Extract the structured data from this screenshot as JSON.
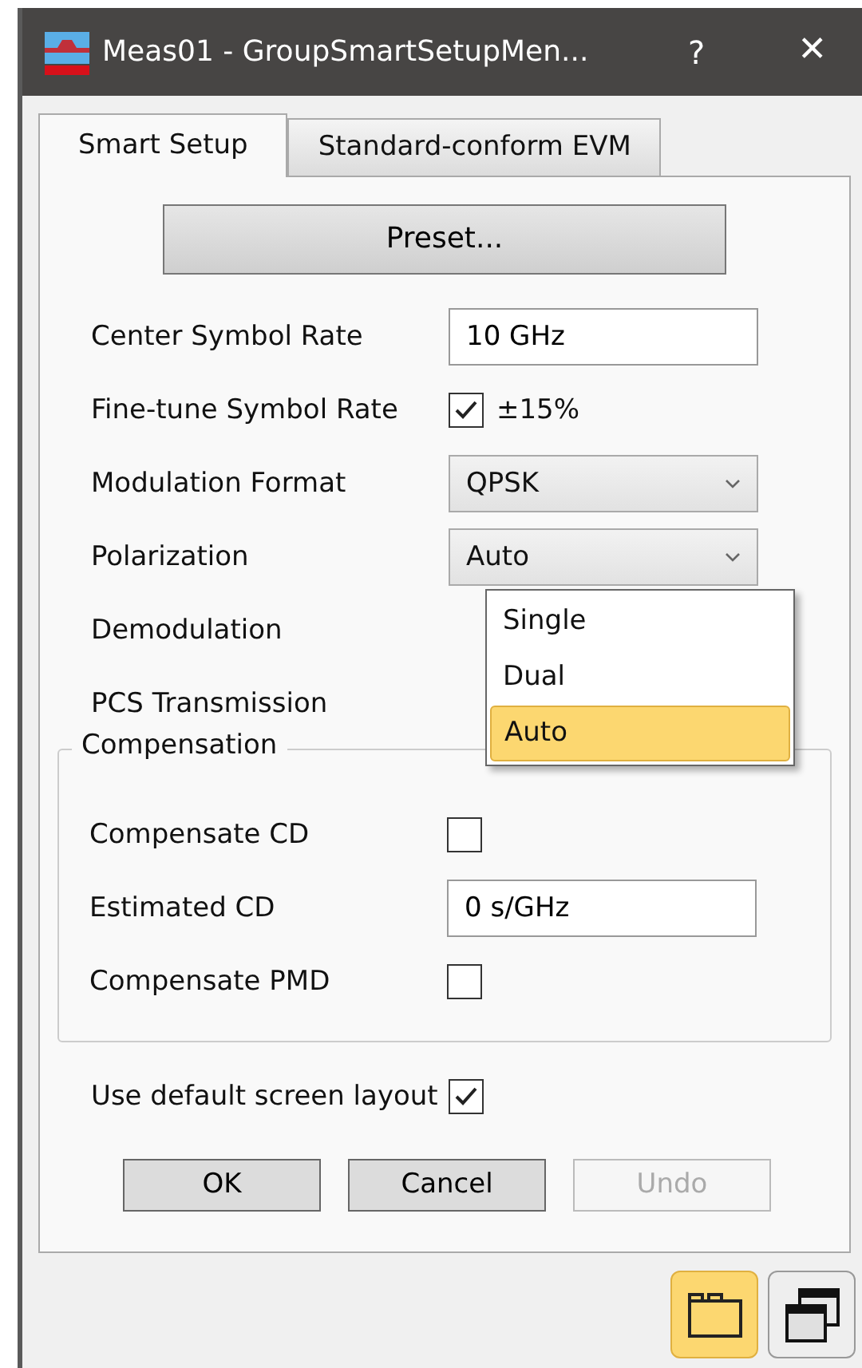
{
  "window": {
    "title": "Meas01 - GroupSmartSetupMen...",
    "help": "?",
    "close": "✕"
  },
  "tabs": [
    {
      "label": "Smart Setup",
      "selected": true
    },
    {
      "label": "Standard-conform EVM",
      "selected": false
    }
  ],
  "preset_button": "Preset...",
  "settings": [
    {
      "kind": "text",
      "label": "Center Symbol Rate",
      "value": "10 GHz"
    },
    {
      "kind": "checkbox",
      "label": "Fine-tune Symbol Rate",
      "checked": true,
      "text": "±15%"
    },
    {
      "kind": "dropdown",
      "label": "Modulation Format",
      "value": "QPSK"
    },
    {
      "kind": "dropdown",
      "label": "Polarization",
      "value": "Auto",
      "expanded": true,
      "options": [
        {
          "label": "Single",
          "selected": false
        },
        {
          "label": "Dual",
          "selected": false
        },
        {
          "label": "Auto",
          "selected": true
        }
      ]
    },
    {
      "kind": "covered",
      "label": "Demodulation"
    },
    {
      "kind": "covered",
      "label": "PCS Transmission"
    }
  ],
  "compensation": {
    "title": "Compensation",
    "settings": [
      {
        "kind": "checkbox",
        "label": "Compensate CD",
        "checked": false
      },
      {
        "kind": "text",
        "label": "Estimated CD",
        "value": "0 s/GHz"
      },
      {
        "kind": "checkbox",
        "label": "Compensate PMD",
        "checked": false
      }
    ]
  },
  "default_layout": {
    "label": "Use default screen layout",
    "checked": true
  },
  "buttons": [
    {
      "label": "OK",
      "disabled": false
    },
    {
      "label": "Cancel",
      "disabled": false
    },
    {
      "label": "Undo",
      "disabled": true
    }
  ],
  "view_buttons": [
    {
      "kind": "folder",
      "selected": true
    },
    {
      "kind": "windows",
      "selected": false
    }
  ]
}
